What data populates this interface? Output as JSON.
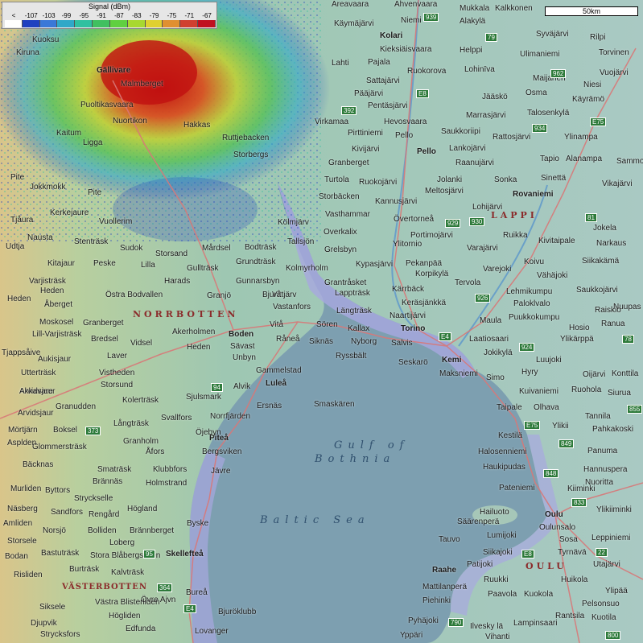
{
  "legend": {
    "title": "Signal (dBm)",
    "labels": [
      "<",
      "-107",
      "-103",
      "-99",
      "-95",
      "-91",
      "-87",
      "-83",
      "-79",
      "-75",
      "-71",
      "-67"
    ],
    "colors": [
      "#ffffff",
      "#2040c0",
      "#3a78d8",
      "#30a8c8",
      "#30c0a0",
      "#40c060",
      "#60d040",
      "#a8d830",
      "#e0d030",
      "#e09030",
      "#d04030",
      "#c01020"
    ]
  },
  "scale": {
    "label": "50km"
  },
  "colors": {
    "sea": "#7d9fb0",
    "land": "#a6c7b8",
    "coast_shallow": "#a8a8e0",
    "road": "#d87878",
    "signal_hot": "#c01010"
  },
  "map": {
    "regions": [
      "NORRBOTTEN",
      "LAPPI",
      "OULU",
      "VÄSTERBOTTEN"
    ],
    "water": [
      "Gulf of",
      "Bothnia",
      "Baltic Sea"
    ],
    "road_signs": [
      "939",
      "79",
      "E8",
      "392",
      "962",
      "934",
      "E75",
      "929",
      "930",
      "81",
      "926",
      "E4",
      "924",
      "78",
      "94",
      "373",
      "E75",
      "849",
      "848",
      "833",
      "22",
      "E8",
      "95",
      "364",
      "E4",
      "790",
      "800",
      "855"
    ],
    "places": [
      "Areavaara",
      "Ahvenvaara",
      "Kalkkonen",
      "Mukkala",
      "Käymäjärvi",
      "Niemi",
      "Alakylä",
      "Syväjärvi",
      "Rilpi",
      "Kolari",
      "Torvinen",
      "Kieksiäisvaara",
      "Helppi",
      "Ulimaniemi",
      "Lahti",
      "Pajala",
      "Lohinīva",
      "Vuojärvi",
      "Ruokorova",
      "Maijanen",
      "Niesi",
      "Sattajärvi",
      "Jääskö",
      "Osma",
      "Käyrämö",
      "Pääjärvi",
      "Pentäsjärvi",
      "Marrasjärvi",
      "Talosenkylä",
      "Virkamaa",
      "Hevosvaara",
      "Saukkoriipi",
      "Pirttiniemi",
      "Pello",
      "Rattosjärvi",
      "Ylinampa",
      "Kivijärvi",
      "Lankojärvi",
      "Tapio",
      "Alanampa",
      "Sammo",
      "Granberget",
      "Pello",
      "Raanujärvi",
      "Turtola",
      "Ruokojärvi",
      "Jolanki",
      "Sonka",
      "Sinettä",
      "Vikajärvi",
      "Storbäcken",
      "Meltosjärvi",
      "Kannusjärvi",
      "Rovaniemi",
      "Lohijärvi",
      "Vasthammar",
      "Övertorneå",
      "Kölmjärv",
      "Overkalix",
      "Portimojärvi",
      "Jokela",
      "Tallsjön",
      "Ylitornio",
      "Ruikka",
      "Kivitaipale",
      "Narkaus",
      "Grelsbyn",
      "Varajärvi",
      "Kypasjärvi",
      "Pekanpää",
      "Koivu",
      "Siikakämä",
      "Kolmyrholm",
      "Korpikylä",
      "Varejoki",
      "Vähäjoki",
      "Grantråsket",
      "Tervola",
      "Lehmikumpu",
      "Saukkojärvi",
      "Lappträsk",
      "Kärrbäck",
      "Paloklvalo",
      "Nuupas",
      "Keräsjänkkä",
      "Vittjärv",
      "Vastanfors",
      "Längträsk",
      "Naartijärvi",
      "Puukkokumpu",
      "Raiskio",
      "Ranua",
      "Boden",
      "Vitå",
      "Sören",
      "Kallax",
      "Torino",
      "Maula",
      "Hosio",
      "Råneå",
      "Siknäs",
      "Nyborg",
      "Salvis",
      "Laatiosaari",
      "Ylikärppä",
      "Sävast",
      "Unbyn",
      "Ryssbält",
      "Seskarö",
      "Kemi",
      "Jokikylä",
      "Luujoki",
      "Heden",
      "Gammelstad",
      "Maksniemi",
      "Simo",
      "Hyry",
      "Oijärvi",
      "Konttila",
      "Luleå",
      "Kuivaniemi",
      "Ruohola",
      "Siurua",
      "Smaskären",
      "Ersnäs",
      "Taipale",
      "Olhava",
      "Tannila",
      "Norrfjärden",
      "Ylikii",
      "Pahkakoski",
      "Piteå",
      "Kestilä",
      "Panuma",
      "Bergsviken",
      "Halosenniemi",
      "Hannuspera",
      "Haukipudas",
      "Nuoritta",
      "Jävre",
      "Pateniemi",
      "Kiiminki",
      "Ylikiiminki",
      "Hailuoto",
      "Oulu",
      "Säärenperä",
      "Oulunsalo",
      "Leppiniemi",
      "Lumijoki",
      "Sosa",
      "Tyrnävä",
      "Siikajoki",
      "Utajärvi",
      "Patijoki",
      "Raahe",
      "Ruukki",
      "Huikola",
      "Mattilanperä",
      "Paavola",
      "Ylipää",
      "Piehinki",
      "Kuokola",
      "Pelsonsuo",
      "Rantsila",
      "Kuotila",
      "Pyhäjoki",
      "Lampinsaari",
      "Yppäri",
      "Ilvesky lä",
      "Vihanti",
      "Tauvo",
      "Byske",
      "Skellefteå",
      "Bureå",
      "Bjuröklubb",
      "Lovanger",
      "Storbergs",
      "Jokkmokk",
      "Kiruna",
      "Kuoksu",
      "Gällivare",
      "Malmberget",
      "Puoltikasvaara",
      "Ligga",
      "Nuortikon",
      "Kaitum",
      "Hakkas",
      "Ruttjebacken",
      "Vuollerim",
      "Kerkejaure",
      "Nausta",
      "Udtja",
      "Tjåura",
      "Pite",
      "Stenträsk",
      "Kitajaur",
      "Peske",
      "Harads",
      "Sudok",
      "Lilla",
      "Storsand",
      "Gullträsk",
      "Mårdsel",
      "Bodträsk",
      "Grundträsk",
      "Gunnarsbyn",
      "Granjö",
      "Bjurå",
      "Östra Bodvallen",
      "Heden",
      "Åberget",
      "Moskosel",
      "Granberget",
      "Bredsel",
      "Vidsel",
      "Laver",
      "Akerholmen",
      "Arvidsjaur",
      "Vistheden",
      "Storsund",
      "Kolerträsk",
      "Sjulsmark",
      "Alvik",
      "Långträsk",
      "Svallfors",
      "Öjebyn",
      "Granudden",
      "Boksel",
      "Glommersträsk",
      "Granholm",
      "Åfors",
      "Smaträsk",
      "Klubbfors",
      "Holmstrand",
      "Brännäs",
      "Stryckselle",
      "Högland",
      "Rengård",
      "Bolliden",
      "Brännberget",
      "Norsjö",
      "Bastuträsk",
      "Loberg",
      "Stora Blåbergsliden",
      "Kalvträsk",
      "Burträsk",
      "Övre Ajvn",
      "Västra Blisterliden",
      "Högliden",
      "Edfunda",
      "Strycksfors",
      "Djupvik",
      "Siksele",
      "Risliden",
      "Bodan",
      "Storsele",
      "Amliden",
      "Näsberg",
      "Murliden",
      "Byttors",
      "Sandfors",
      "Bäcknas",
      "Mörtjärn",
      "Asplden",
      "Arvidsjaur",
      "Akkavare",
      "Utterträsk",
      "Aukisjaur",
      "Tjappsåive",
      "Lill-Varjisträsk",
      "Varjisträsk",
      "Heden",
      "Pite"
    ]
  }
}
